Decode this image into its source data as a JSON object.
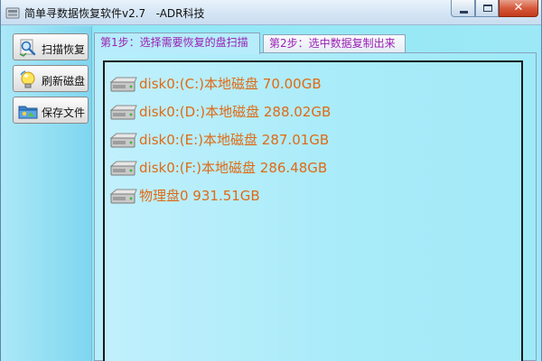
{
  "window": {
    "title": "简单寻数据恢复软件v2.7   -ADR科技",
    "icon": "app-icon",
    "controls": {
      "minimize": "minimize-icon",
      "maximize": "maximize-icon",
      "close": "close-icon",
      "close_glyph": "✕"
    }
  },
  "sidebar": {
    "buttons": [
      {
        "label": "扫描恢复",
        "icon": "magnifier-icon"
      },
      {
        "label": "刷新磁盘",
        "icon": "refresh-lightbulb-icon"
      },
      {
        "label": "保存文件",
        "icon": "save-folder-icon"
      }
    ]
  },
  "tabs": [
    {
      "label": "第1步：选择需要恢复的盘扫描",
      "active": true
    },
    {
      "label": "第2步：选中数据复制出来",
      "active": false
    }
  ],
  "disks": [
    {
      "label": "disk0:(C:)本地磁盘 70.00GB",
      "icon": "hard-drive-icon"
    },
    {
      "label": "disk0:(D:)本地磁盘 288.02GB",
      "icon": "hard-drive-icon"
    },
    {
      "label": "disk0:(E:)本地磁盘 287.01GB",
      "icon": "hard-drive-icon"
    },
    {
      "label": "disk0:(F:)本地磁盘 286.48GB",
      "icon": "hard-drive-icon"
    },
    {
      "label": "物理盘0 931.51GB",
      "icon": "hard-drive-icon"
    }
  ],
  "colors": {
    "disk_text": "#e06a14",
    "tab_text": "#9b1fb3",
    "close_button": "#c23a1a"
  }
}
